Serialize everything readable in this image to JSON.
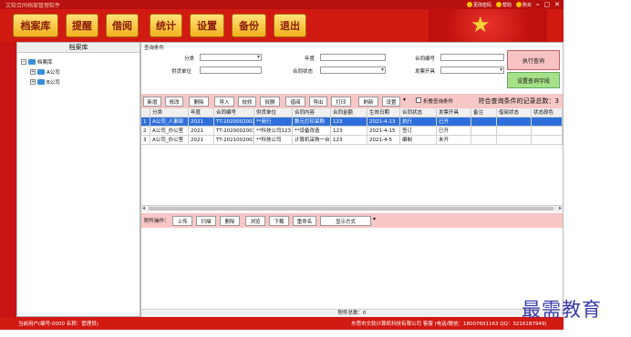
{
  "app": {
    "title": "文软合同档案管理软件",
    "title_links": [
      "更改密码",
      "帮助",
      "购买"
    ]
  },
  "toolbar": {
    "buttons": [
      "档案库",
      "提醒",
      "借阅",
      "统计",
      "设置",
      "备份",
      "退出"
    ]
  },
  "sidebar": {
    "header": "档案库",
    "root": "档案库",
    "items": [
      "A公司",
      "B公司"
    ]
  },
  "query": {
    "section_label": "查询条件",
    "category_label": "分类",
    "year_label": "年度",
    "contract_no_label": "合同编号",
    "supplier_label": "供货单位",
    "contract_status_label": "合同状态",
    "invoice_label": "发票开具",
    "execute_button": "执行查询",
    "set_fields_button": "设置查询字段"
  },
  "actions": {
    "buttons": [
      "新增",
      "修改",
      "删除",
      "导入",
      "批修",
      "批删",
      "借阅",
      "导出",
      "打印",
      "刷新",
      "设置"
    ],
    "dropdown_glyph": "▾",
    "fold_label": "折叠查询条件",
    "count_text": "符合查询条件的记录总数：3"
  },
  "table": {
    "columns": [
      "",
      "分类",
      "年度",
      "合同编号",
      "供货单位",
      "合同内容",
      "合同金额",
      "生效日期",
      "合同状态",
      "发票开具",
      "备注",
      "借阅状态",
      "状态颜色"
    ],
    "rows": [
      [
        "1",
        "A公司_人事部",
        "2021",
        "TT-2020002002",
        "**商行",
        "数元打印采购",
        "123",
        "2021-4-13",
        "执行",
        "已开",
        "",
        "",
        ""
      ],
      [
        "2",
        "A公司_办公室",
        "2021",
        "TT-2020002003",
        "**科技公司123",
        "**设备改造",
        "123",
        "2021-4-15",
        "签订",
        "已开",
        "",
        "",
        ""
      ],
      [
        "3",
        "A公司_办公室",
        "2021",
        "TT-2021002001",
        "**科技公司",
        "计算机采购一台",
        "123",
        "2021-4-5",
        "编制",
        "未开",
        "",
        "",
        ""
      ]
    ]
  },
  "attachments": {
    "label": "附件操作：",
    "buttons": [
      "上传",
      "扫描",
      "删除",
      "浏览",
      "下载",
      "重命名",
      "显示方式"
    ],
    "total_label": "附件总数：0"
  },
  "status": {
    "user": "当前用户(编号:0000 名称：管理员)",
    "company": "东莞市文软计算机科技有限公司 客服 (电话/微信：18007691163  QQ：3216187949)"
  },
  "watermark": "最需教育",
  "colors": {
    "app_red": "#c91414",
    "button_gold": "#f2b21e",
    "selected_row": "#2f6fdb",
    "bar_pink": "#f7c6c6",
    "exec_button": "#f6c2c2",
    "setq_button": "#a6e088"
  }
}
